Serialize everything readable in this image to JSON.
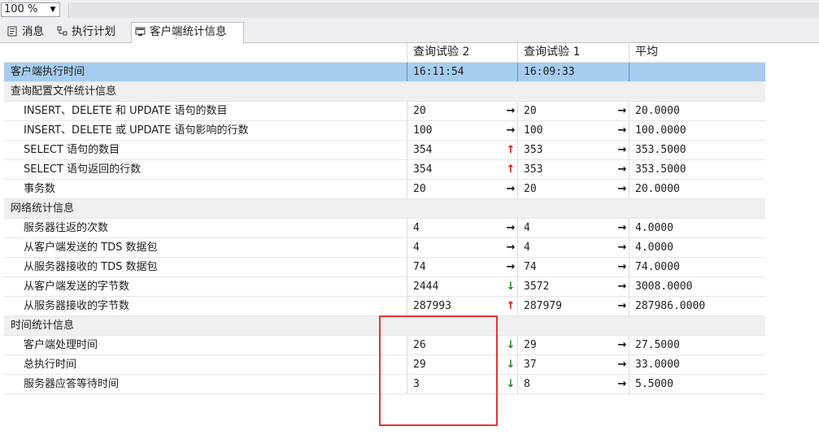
{
  "zoom": {
    "value": "100 %"
  },
  "tabs": [
    {
      "label": "消息",
      "icon": "messages-icon"
    },
    {
      "label": "执行计划",
      "icon": "execution-plan-icon"
    },
    {
      "label": "客户端统计信息",
      "icon": "client-statistics-icon"
    }
  ],
  "grid": {
    "headers": [
      "",
      "查询试验 2",
      "查询试验 1",
      "平均"
    ],
    "rows": [
      {
        "label": "客户端执行时间",
        "v1": "16:11:54",
        "v2": "16:09:33",
        "avg": ""
      },
      {
        "label": "查询配置文件统计信息",
        "section": true
      },
      {
        "label": "INSERT、DELETE 和 UPDATE 语句的数目",
        "v1": "20",
        "a1": "→",
        "v2": "20",
        "a2": "→",
        "avg": "20.0000"
      },
      {
        "label": "INSERT、DELETE 或 UPDATE 语句影响的行数",
        "v1": "100",
        "a1": "→",
        "v2": "100",
        "a2": "→",
        "avg": "100.0000"
      },
      {
        "label": "SELECT 语句的数目",
        "v1": "354",
        "a1": "↑",
        "v2": "353",
        "a2": "→",
        "avg": "353.5000"
      },
      {
        "label": "SELECT 语句返回的行数",
        "v1": "354",
        "a1": "↑",
        "v2": "353",
        "a2": "→",
        "avg": "353.5000"
      },
      {
        "label": "事务数",
        "v1": "20",
        "a1": "→",
        "v2": "20",
        "a2": "→",
        "avg": "20.0000"
      },
      {
        "label": "网络统计信息",
        "section": true
      },
      {
        "label": "服务器往返的次数",
        "v1": "4",
        "a1": "→",
        "v2": "4",
        "a2": "→",
        "avg": "4.0000"
      },
      {
        "label": "从客户端发送的 TDS 数据包",
        "v1": "4",
        "a1": "→",
        "v2": "4",
        "a2": "→",
        "avg": "4.0000"
      },
      {
        "label": "从服务器接收的 TDS 数据包",
        "v1": "74",
        "a1": "→",
        "v2": "74",
        "a2": "→",
        "avg": "74.0000"
      },
      {
        "label": "从客户端发送的字节数",
        "v1": "2444",
        "a1": "↓",
        "v2": "3572",
        "a2": "→",
        "avg": "3008.0000"
      },
      {
        "label": "从服务器接收的字节数",
        "v1": "287993",
        "a1": "↑",
        "v2": "287979",
        "a2": "→",
        "avg": "287986.0000"
      },
      {
        "label": "时间统计信息",
        "section": true
      },
      {
        "label": "客户端处理时间",
        "v1": "26",
        "a1": "↓",
        "v2": "29",
        "a2": "→",
        "avg": "27.5000"
      },
      {
        "label": "总执行时间",
        "v1": "29",
        "a1": "↓",
        "v2": "37",
        "a2": "→",
        "avg": "33.0000"
      },
      {
        "label": "服务器应答等待时间",
        "v1": "3",
        "a1": "↓",
        "v2": "8",
        "a2": "→",
        "avg": "5.5000"
      }
    ]
  },
  "colors": {
    "selected_row": "#a6cdf0",
    "section_row": "#f0f0f0",
    "arrow_up": "#e01010",
    "arrow_down": "#1a8a1a",
    "highlight_box": "#e53333"
  }
}
